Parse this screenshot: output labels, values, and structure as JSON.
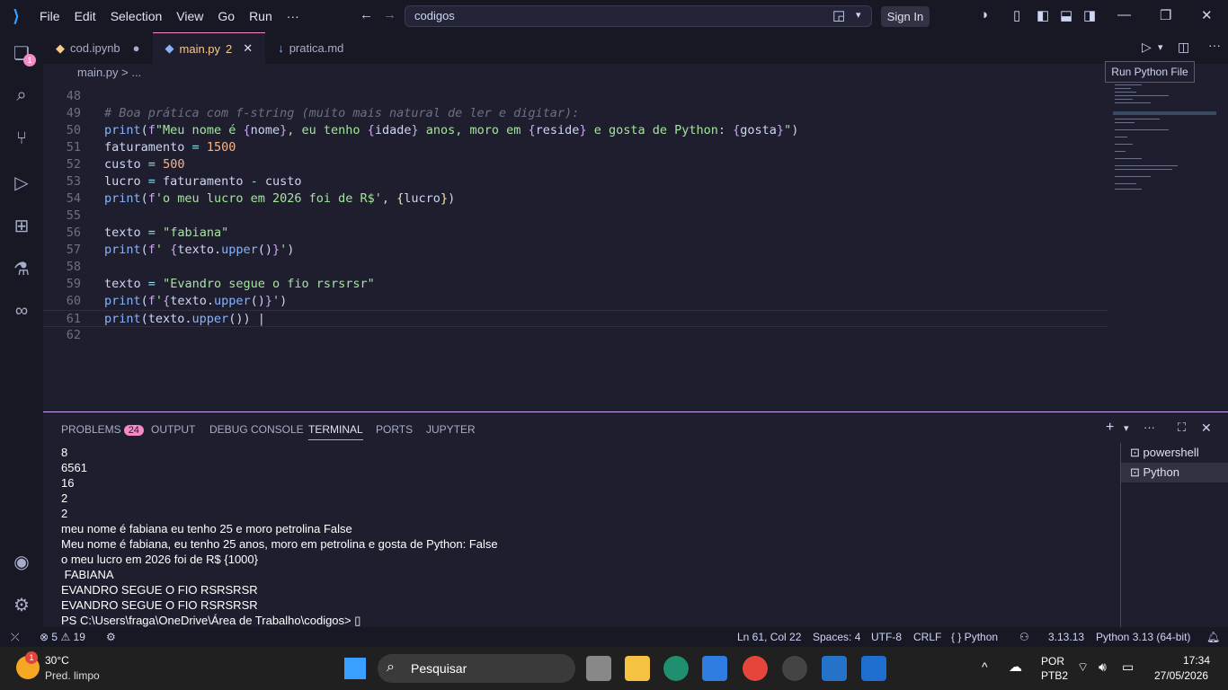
{
  "titlebar": {
    "menu": [
      "File",
      "Edit",
      "Selection",
      "View",
      "Go",
      "Run",
      "···"
    ],
    "search": "codigos",
    "signin": "Sign In"
  },
  "activity": {
    "explorer_badge": "1"
  },
  "tabs": [
    {
      "label": "cod.ipynb",
      "state": "●"
    },
    {
      "label": "main.py",
      "state": "2",
      "active": true
    },
    {
      "label": "pratica.md",
      "state": ""
    }
  ],
  "breadcrumb": "main.py > ...",
  "tooltip": "Run Python File",
  "editor": {
    "lines": [
      {
        "n": "48",
        "html": ""
      },
      {
        "n": "49",
        "html": "<span class=\"cmt\"># Boa prática com f-string (muito mais natural de ler e digitar):</span>"
      },
      {
        "n": "50",
        "html": "<span class=\"fn\">print</span>(<span class=\"kw\">f</span><span class=\"str\">\"Meu nome é </span><span class=\"kw\">{</span>nome<span class=\"kw\">}</span><span class=\"str\">, eu tenho </span><span class=\"kw\">{</span>idade<span class=\"kw\">}</span><span class=\"str\"> anos, moro em </span><span class=\"kw\">{</span>reside<span class=\"kw\">}</span><span class=\"str\"> e gosta de Python: </span><span class=\"kw\">{</span>gosta<span class=\"kw\">}</span><span class=\"str\">\"</span>)"
      },
      {
        "n": "51",
        "html": "faturamento <span class=\"op\">=</span> <span class=\"num\">1500</span>"
      },
      {
        "n": "52",
        "html": "custo <span class=\"op\">=</span> <span class=\"num\">500</span>"
      },
      {
        "n": "53",
        "html": "lucro <span class=\"op\">=</span> faturamento <span class=\"op\">-</span> custo"
      },
      {
        "n": "54",
        "html": "<span class=\"fn\">print</span>(<span class=\"kw\">f</span><span class=\"str\">'o meu lucro em 2026 foi de R$'</span>, <span class=\"br\">{</span>lucro<span class=\"br\">}</span>)"
      },
      {
        "n": "55",
        "html": ""
      },
      {
        "n": "56",
        "html": "texto <span class=\"op\">=</span> <span class=\"str\">\"fabiana\"</span>"
      },
      {
        "n": "57",
        "html": "<span class=\"fn\">print</span>(<span class=\"kw\">f</span><span class=\"str\">' </span><span class=\"kw\">{</span>texto.<span class=\"fn\">upper</span>()<span class=\"kw\">}</span><span class=\"str\">'</span>)"
      },
      {
        "n": "58",
        "html": ""
      },
      {
        "n": "59",
        "html": "texto <span class=\"op\">=</span> <span class=\"str\">\"Evandro segue o fio rsrsrsr\"</span>"
      },
      {
        "n": "60",
        "html": "<span class=\"fn\">print</span>(<span class=\"kw\">f</span><span class=\"str\">'</span><span class=\"kw\">{</span>texto.<span class=\"fn\">upper</span>()<span class=\"kw\">}</span><span class=\"str\">'</span>)"
      },
      {
        "n": "61",
        "html": "<span class=\"fn\">print</span>(texto.<span class=\"fn\">upper</span>()) |"
      },
      {
        "n": "62",
        "html": ""
      }
    ]
  },
  "panel": {
    "tabs": [
      "PROBLEMS",
      "OUTPUT",
      "DEBUG CONSOLE",
      "TERMINAL",
      "PORTS",
      "JUPYTER"
    ],
    "problems_count": "24",
    "terminal_output": "8\n6561\n16\n2\n2\nmeu nome é fabiana eu tenho 25 e moro petrolina False\nMeu nome é fabiana, eu tenho 25 anos, moro em petrolina e gosta de Python: False\no meu lucro em 2026 foi de R$ {1000}\n FABIANA\nEVANDRO SEGUE O FIO RSRSRSR\nEVANDRO SEGUE O FIO RSRSRSR\nPS C:\\Users\\fraga\\OneDrive\\Área de Trabalho\\codigos> ▯",
    "terminals": [
      "powershell",
      "Python"
    ]
  },
  "status": {
    "errors": "5",
    "warnings": "19",
    "position": "Ln 61, Col 22",
    "spaces": "Spaces: 4",
    "encoding": "UTF-8",
    "eol": "CRLF",
    "language": "{ } Python",
    "version": "3.13.13",
    "interpreter": "Python 3.13 (64-bit)"
  },
  "taskbar": {
    "weather_temp": "30°C",
    "weather_desc": "Pred. limpo",
    "weather_badge": "1",
    "search": "Pesquisar",
    "lang1": "POR",
    "lang2": "PTB2",
    "time": "17:34",
    "date": "27/05/2026"
  }
}
